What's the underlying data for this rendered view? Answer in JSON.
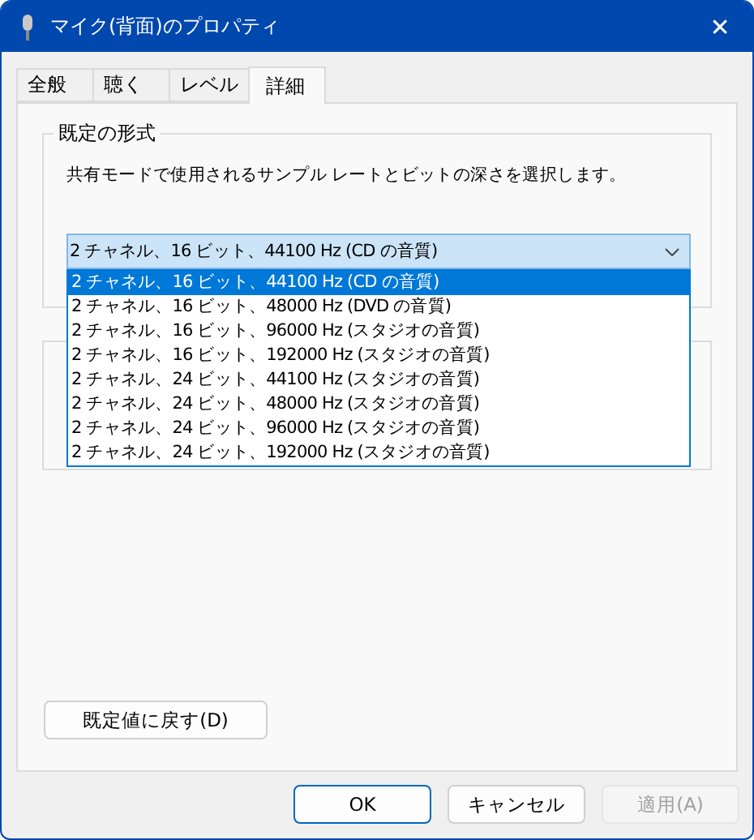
{
  "window": {
    "title": "マイク(背面)のプロパティ",
    "close": "✕"
  },
  "tabs": [
    {
      "label": "全般",
      "selected": false
    },
    {
      "label": "聴く",
      "selected": false
    },
    {
      "label": "レベル",
      "selected": false
    },
    {
      "label": "詳細",
      "selected": true
    }
  ],
  "default_format": {
    "title": "既定の形式",
    "description": "共有モードで使用されるサンプル レートとビットの深さを選択します。",
    "value": "2 チャネル、16 ビット、44100 Hz (CD の音質)",
    "expanded": true,
    "options": [
      {
        "label": "2 チャネル、16 ビット、44100 Hz (CD の音質)",
        "selected": true
      },
      {
        "label": "2 チャネル、16 ビット、48000 Hz (DVD の音質)",
        "selected": false
      },
      {
        "label": "2 チャネル、16 ビット、96000 Hz (スタジオの音質)",
        "selected": false
      },
      {
        "label": "2 チャネル、16 ビット、192000 Hz (スタジオの音質)",
        "selected": false
      },
      {
        "label": "2 チャネル、24 ビット、44100 Hz (スタジオの音質)",
        "selected": false
      },
      {
        "label": "2 チャネル、24 ビット、48000 Hz (スタジオの音質)",
        "selected": false
      },
      {
        "label": "2 チャネル、24 ビット、96000 Hz (スタジオの音質)",
        "selected": false
      },
      {
        "label": "2 チャネル、24 ビット、192000 Hz (スタジオの音質)",
        "selected": false
      }
    ]
  },
  "restore_button": "既定値に戻す(D)",
  "buttons": [
    {
      "label": "OK",
      "kind": "default",
      "disabled": false
    },
    {
      "label": "キャンセル",
      "kind": "normal",
      "disabled": false
    },
    {
      "label": "適用(A)",
      "kind": "normal",
      "disabled": true
    }
  ]
}
